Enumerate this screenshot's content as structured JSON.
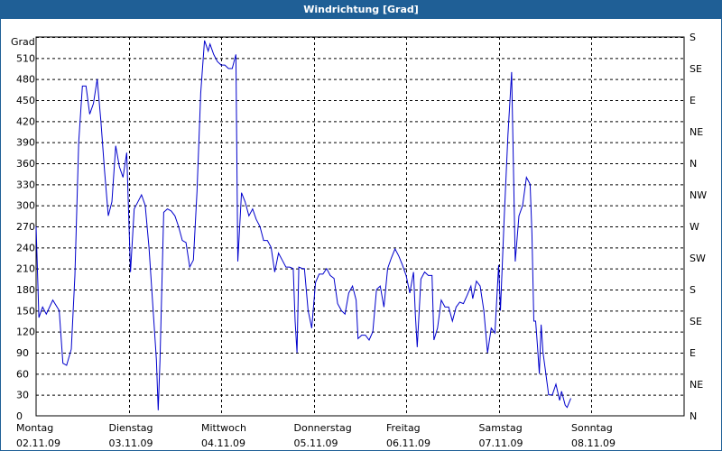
{
  "window": {
    "title": "Windrichtung [Grad]"
  },
  "chart_data": {
    "type": "line",
    "title": "Windrichtung [Grad]",
    "ylabel": "Grad",
    "ylim": [
      0,
      540
    ],
    "yticks": [
      0,
      30,
      60,
      90,
      120,
      150,
      180,
      210,
      240,
      270,
      300,
      330,
      360,
      390,
      420,
      450,
      480,
      510
    ],
    "right_axis_labels": [
      "N",
      "NE",
      "E",
      "SE",
      "S",
      "SW",
      "W",
      "NW",
      "N",
      "NE",
      "E",
      "SE",
      "S"
    ],
    "x_labels": [
      {
        "day": "Montag",
        "date": "02.11.09"
      },
      {
        "day": "Dienstag",
        "date": "03.11.09"
      },
      {
        "day": "Mittwoch",
        "date": "04.11.09"
      },
      {
        "day": "Donnerstag",
        "date": "05.11.09"
      },
      {
        "day": "Freitag",
        "date": "06.11.09"
      },
      {
        "day": "Samstag",
        "date": "07.11.09"
      },
      {
        "day": "Sonntag",
        "date": "08.11.09"
      }
    ],
    "grid": true,
    "series": [
      {
        "color": "#0000cc",
        "points": [
          [
            0.0,
            270
          ],
          [
            0.03,
            140
          ],
          [
            0.07,
            155
          ],
          [
            0.11,
            145
          ],
          [
            0.18,
            165
          ],
          [
            0.25,
            150
          ],
          [
            0.29,
            75
          ],
          [
            0.33,
            72
          ],
          [
            0.38,
            95
          ],
          [
            0.42,
            200
          ],
          [
            0.46,
            390
          ],
          [
            0.5,
            470
          ],
          [
            0.54,
            470
          ],
          [
            0.58,
            430
          ],
          [
            0.62,
            445
          ],
          [
            0.66,
            480
          ],
          [
            0.7,
            420
          ],
          [
            0.74,
            350
          ],
          [
            0.78,
            285
          ],
          [
            0.82,
            305
          ],
          [
            0.86,
            385
          ],
          [
            0.9,
            355
          ],
          [
            0.94,
            340
          ],
          [
            0.98,
            375
          ],
          [
            1.0,
            290
          ],
          [
            1.02,
            205
          ],
          [
            1.06,
            295
          ],
          [
            1.1,
            305
          ],
          [
            1.14,
            315
          ],
          [
            1.18,
            300
          ],
          [
            1.22,
            240
          ],
          [
            1.26,
            160
          ],
          [
            1.3,
            80
          ],
          [
            1.32,
            8
          ],
          [
            1.34,
            80
          ],
          [
            1.38,
            290
          ],
          [
            1.42,
            295
          ],
          [
            1.46,
            292
          ],
          [
            1.5,
            285
          ],
          [
            1.54,
            270
          ],
          [
            1.58,
            250
          ],
          [
            1.62,
            247
          ],
          [
            1.66,
            212
          ],
          [
            1.7,
            222
          ],
          [
            1.74,
            320
          ],
          [
            1.78,
            460
          ],
          [
            1.82,
            535
          ],
          [
            1.86,
            520
          ],
          [
            1.88,
            530
          ],
          [
            1.92,
            515
          ],
          [
            1.96,
            505
          ],
          [
            2.0,
            500
          ],
          [
            2.04,
            500
          ],
          [
            2.08,
            495
          ],
          [
            2.12,
            495
          ],
          [
            2.16,
            515
          ],
          [
            2.18,
            220
          ],
          [
            2.22,
            318
          ],
          [
            2.26,
            305
          ],
          [
            2.3,
            285
          ],
          [
            2.34,
            295
          ],
          [
            2.38,
            280
          ],
          [
            2.42,
            270
          ],
          [
            2.46,
            250
          ],
          [
            2.5,
            250
          ],
          [
            2.54,
            240
          ],
          [
            2.58,
            205
          ],
          [
            2.62,
            232
          ],
          [
            2.66,
            222
          ],
          [
            2.7,
            212
          ],
          [
            2.74,
            212
          ],
          [
            2.78,
            210
          ],
          [
            2.8,
            135
          ],
          [
            2.82,
            90
          ],
          [
            2.84,
            212
          ],
          [
            2.88,
            210
          ],
          [
            2.9,
            210
          ],
          [
            2.94,
            150
          ],
          [
            2.98,
            125
          ],
          [
            3.02,
            190
          ],
          [
            3.06,
            202
          ],
          [
            3.1,
            202
          ],
          [
            3.14,
            210
          ],
          [
            3.18,
            200
          ],
          [
            3.22,
            196
          ],
          [
            3.26,
            160
          ],
          [
            3.3,
            150
          ],
          [
            3.34,
            145
          ],
          [
            3.38,
            175
          ],
          [
            3.42,
            185
          ],
          [
            3.46,
            165
          ],
          [
            3.48,
            110
          ],
          [
            3.52,
            115
          ],
          [
            3.56,
            115
          ],
          [
            3.6,
            108
          ],
          [
            3.64,
            120
          ],
          [
            3.68,
            180
          ],
          [
            3.72,
            185
          ],
          [
            3.76,
            155
          ],
          [
            3.8,
            210
          ],
          [
            3.84,
            225
          ],
          [
            3.88,
            238
          ],
          [
            3.92,
            228
          ],
          [
            3.96,
            215
          ],
          [
            4.0,
            200
          ],
          [
            4.04,
            175
          ],
          [
            4.08,
            205
          ],
          [
            4.1,
            145
          ],
          [
            4.12,
            98
          ],
          [
            4.16,
            195
          ],
          [
            4.2,
            205
          ],
          [
            4.24,
            200
          ],
          [
            4.28,
            200
          ],
          [
            4.3,
            108
          ],
          [
            4.34,
            125
          ],
          [
            4.38,
            165
          ],
          [
            4.42,
            155
          ],
          [
            4.46,
            155
          ],
          [
            4.5,
            135
          ],
          [
            4.54,
            155
          ],
          [
            4.58,
            162
          ],
          [
            4.62,
            160
          ],
          [
            4.66,
            172
          ],
          [
            4.7,
            185
          ],
          [
            4.72,
            167
          ],
          [
            4.76,
            192
          ],
          [
            4.8,
            185
          ],
          [
            4.84,
            150
          ],
          [
            4.88,
            90
          ],
          [
            4.92,
            125
          ],
          [
            4.96,
            118
          ],
          [
            5.0,
            215
          ],
          [
            5.02,
            150
          ],
          [
            5.06,
            280
          ],
          [
            5.1,
            400
          ],
          [
            5.14,
            490
          ],
          [
            5.18,
            220
          ],
          [
            5.22,
            285
          ],
          [
            5.26,
            300
          ],
          [
            5.3,
            340
          ],
          [
            5.34,
            330
          ],
          [
            5.36,
            260
          ],
          [
            5.38,
            135
          ],
          [
            5.4,
            135
          ],
          [
            5.42,
            100
          ],
          [
            5.44,
            60
          ],
          [
            5.46,
            130
          ],
          [
            5.48,
            90
          ],
          [
            5.5,
            70
          ],
          [
            5.54,
            30
          ],
          [
            5.58,
            30
          ],
          [
            5.62,
            45
          ],
          [
            5.66,
            22
          ],
          [
            5.68,
            35
          ],
          [
            5.72,
            15
          ],
          [
            5.74,
            12
          ],
          [
            5.78,
            25
          ]
        ]
      }
    ]
  }
}
